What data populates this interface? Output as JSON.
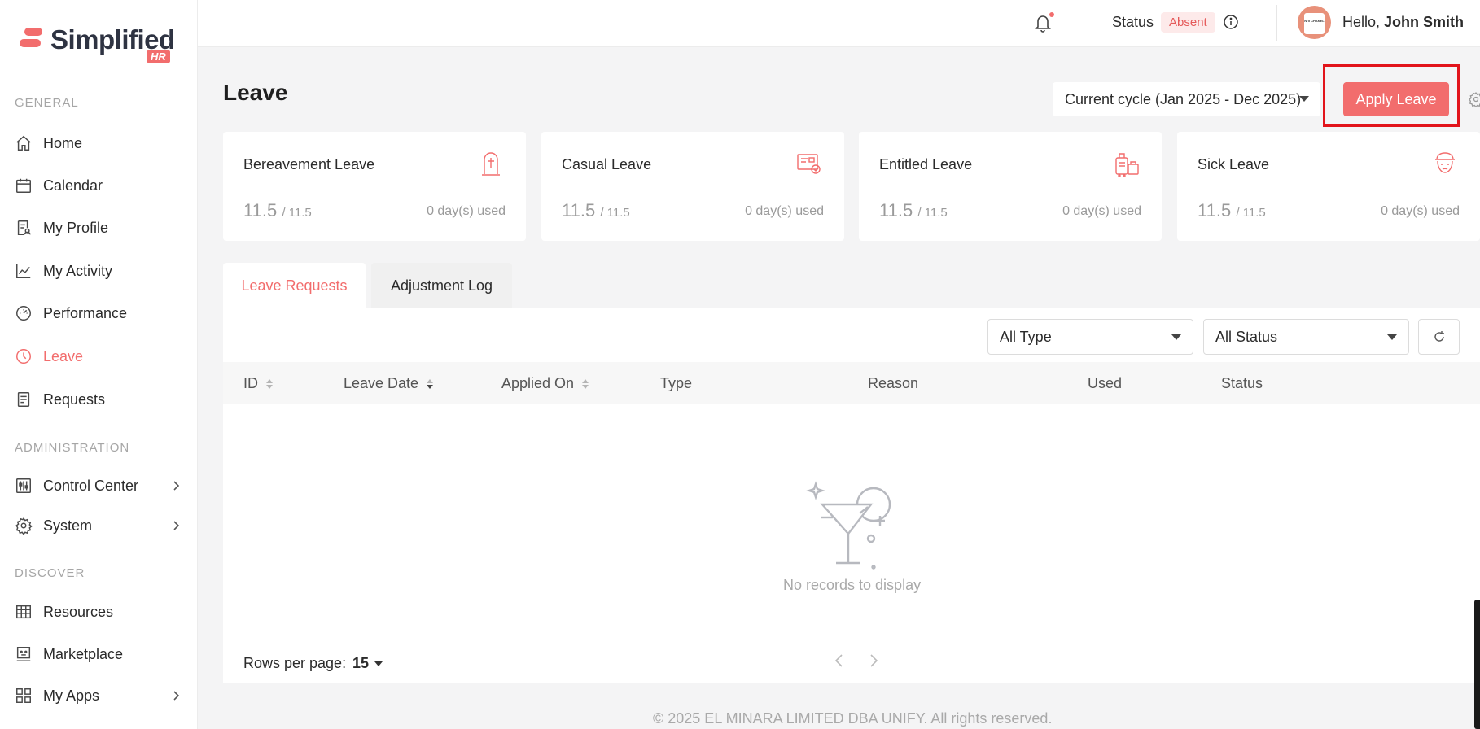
{
  "brand": {
    "name": "Simplified",
    "badge": "HR"
  },
  "sidebar": {
    "sections": [
      {
        "title": "GENERAL"
      },
      {
        "title": "ADMINISTRATION"
      },
      {
        "title": "DISCOVER"
      }
    ],
    "items": [
      {
        "label": "Home",
        "icon": "home-icon"
      },
      {
        "label": "Calendar",
        "icon": "calendar-icon"
      },
      {
        "label": "My Profile",
        "icon": "profile-icon"
      },
      {
        "label": "My Activity",
        "icon": "activity-chart-icon"
      },
      {
        "label": "Performance",
        "icon": "gauge-icon"
      },
      {
        "label": "Leave",
        "icon": "clock-icon",
        "active": true
      },
      {
        "label": "Requests",
        "icon": "request-document-icon"
      },
      {
        "label": "Control Center",
        "icon": "sliders-icon"
      },
      {
        "label": "System",
        "icon": "gear-icon"
      },
      {
        "label": "Resources",
        "icon": "table-grid-icon"
      },
      {
        "label": "Marketplace",
        "icon": "marketplace-icon"
      },
      {
        "label": "My Apps",
        "icon": "apps-grid-icon"
      }
    ]
  },
  "header": {
    "status_label": "Status",
    "status_value": "Absent",
    "greeting": "Hello,",
    "user_name": "John Smith",
    "avatar_text": "N°5 CHANEL"
  },
  "page": {
    "title": "Leave",
    "cycle": "Current cycle (Jan 2025 - Dec 2025)",
    "apply_label": "Apply Leave"
  },
  "cards": [
    {
      "name": "Bereavement Leave",
      "balance": "11.5",
      "total": "/ 11.5",
      "used": "0 day(s) used",
      "icon": "tombstone-icon"
    },
    {
      "name": "Casual Leave",
      "balance": "11.5",
      "total": "/ 11.5",
      "used": "0 day(s) used",
      "icon": "ticket-icon"
    },
    {
      "name": "Entitled Leave",
      "balance": "11.5",
      "total": "/ 11.5",
      "used": "0 day(s) used",
      "icon": "luggage-icon"
    },
    {
      "name": "Sick Leave",
      "balance": "11.5",
      "total": "/ 11.5",
      "used": "0 day(s) used",
      "icon": "sick-face-icon"
    }
  ],
  "tabs": [
    {
      "label": "Leave Requests",
      "active": true
    },
    {
      "label": "Adjustment Log",
      "active": false
    }
  ],
  "filters": {
    "type": "All Type",
    "status": "All Status"
  },
  "table": {
    "columns": [
      "ID",
      "Leave Date",
      "Applied On",
      "Type",
      "Reason",
      "Used",
      "Status"
    ],
    "empty_text": "No records to display"
  },
  "pagination": {
    "rows_label": "Rows per page:",
    "rows_value": "15"
  },
  "footer": "© 2025 EL MINARA LIMITED DBA UNIFY. All rights reserved.",
  "colors": {
    "accent": "#f26d6d",
    "highlight": "#e2141b"
  }
}
